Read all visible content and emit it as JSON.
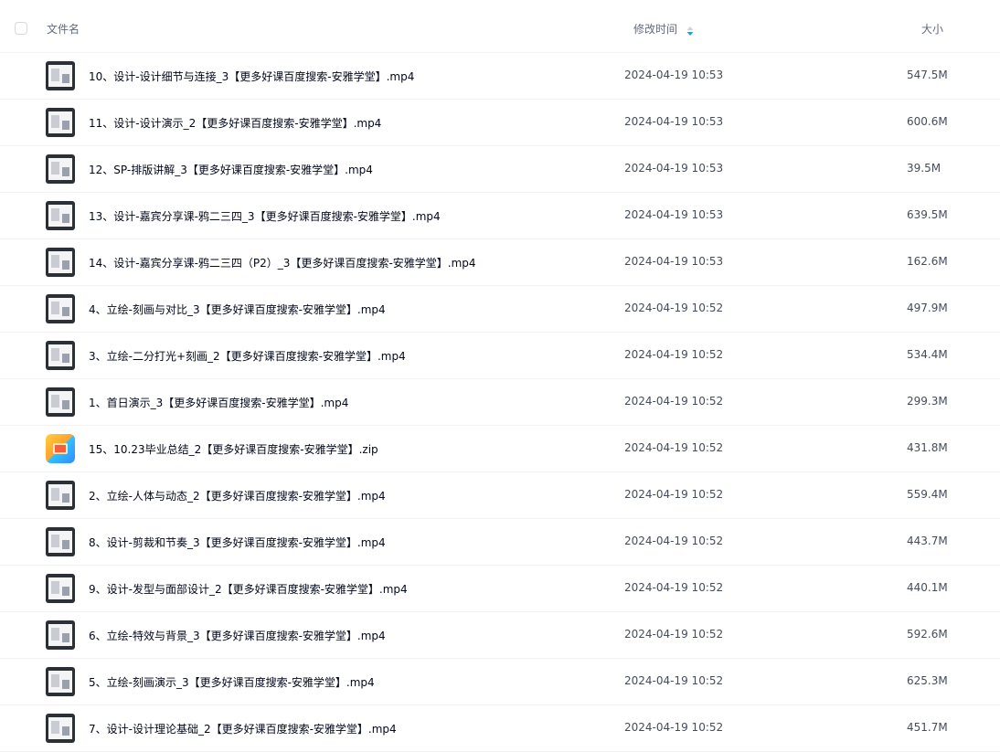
{
  "header": {
    "name_label": "文件名",
    "time_label": "修改时间",
    "size_label": "大小",
    "sort_icon": "sort-desc-icon"
  },
  "colors": {
    "sort_accent": "#06a7ff"
  },
  "files": [
    {
      "name": "10、设计-设计细节与连接_3【更多好课百度搜索-安雅学堂】.mp4",
      "time": "2024-04-19 10:53",
      "size": "547.5M",
      "type": "video"
    },
    {
      "name": "11、设计-设计演示_2【更多好课百度搜索-安雅学堂】.mp4",
      "time": "2024-04-19 10:53",
      "size": "600.6M",
      "type": "video"
    },
    {
      "name": "12、SP-排版讲解_3【更多好课百度搜索-安雅学堂】.mp4",
      "time": "2024-04-19 10:53",
      "size": "39.5M",
      "type": "video"
    },
    {
      "name": "13、设计-嘉宾分享课-鸦二三四_3【更多好课百度搜索-安雅学堂】.mp4",
      "time": "2024-04-19 10:53",
      "size": "639.5M",
      "type": "video"
    },
    {
      "name": "14、设计-嘉宾分享课-鸦二三四（P2）_3【更多好课百度搜索-安雅学堂】.mp4",
      "time": "2024-04-19 10:53",
      "size": "162.6M",
      "type": "video"
    },
    {
      "name": "4、立绘-刻画与对比_3【更多好课百度搜索-安雅学堂】.mp4",
      "time": "2024-04-19 10:52",
      "size": "497.9M",
      "type": "video"
    },
    {
      "name": "3、立绘-二分打光+刻画_2【更多好课百度搜索-安雅学堂】.mp4",
      "time": "2024-04-19 10:52",
      "size": "534.4M",
      "type": "video"
    },
    {
      "name": "1、首日演示_3【更多好课百度搜索-安雅学堂】.mp4",
      "time": "2024-04-19 10:52",
      "size": "299.3M",
      "type": "video"
    },
    {
      "name": "15、10.23毕业总结_2【更多好课百度搜索-安雅学堂】.zip",
      "time": "2024-04-19 10:52",
      "size": "431.8M",
      "type": "zip"
    },
    {
      "name": "2、立绘-人体与动态_2【更多好课百度搜索-安雅学堂】.mp4",
      "time": "2024-04-19 10:52",
      "size": "559.4M",
      "type": "video"
    },
    {
      "name": "8、设计-剪裁和节奏_3【更多好课百度搜索-安雅学堂】.mp4",
      "time": "2024-04-19 10:52",
      "size": "443.7M",
      "type": "video"
    },
    {
      "name": "9、设计-发型与面部设计_2【更多好课百度搜索-安雅学堂】.mp4",
      "time": "2024-04-19 10:52",
      "size": "440.1M",
      "type": "video"
    },
    {
      "name": "6、立绘-特效与背景_3【更多好课百度搜索-安雅学堂】.mp4",
      "time": "2024-04-19 10:52",
      "size": "592.6M",
      "type": "video"
    },
    {
      "name": "5、立绘-刻画演示_3【更多好课百度搜索-安雅学堂】.mp4",
      "time": "2024-04-19 10:52",
      "size": "625.3M",
      "type": "video"
    },
    {
      "name": "7、设计-设计理论基础_2【更多好课百度搜索-安雅学堂】.mp4",
      "time": "2024-04-19 10:52",
      "size": "451.7M",
      "type": "video"
    }
  ]
}
